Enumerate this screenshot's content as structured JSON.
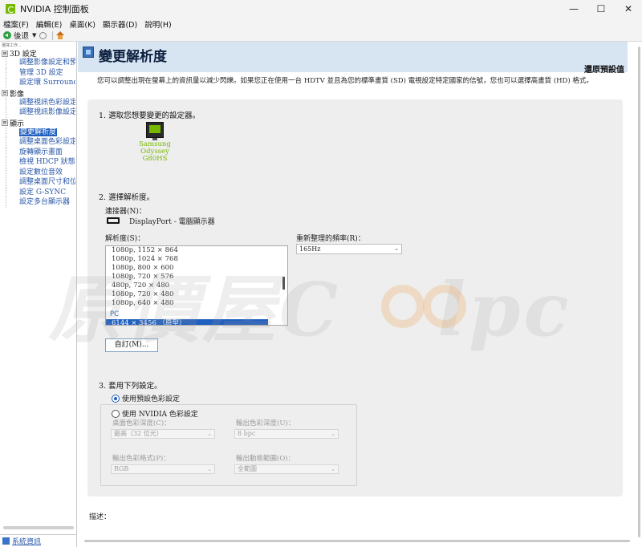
{
  "window": {
    "title": "NVIDIA 控制面板",
    "controls": {
      "minimize": "—",
      "maximize": "☐",
      "close": "✕"
    }
  },
  "menubar": {
    "items": [
      "檔案(F)",
      "編輯(E)",
      "桌面(K)",
      "顯示器(D)",
      "說明(H)"
    ]
  },
  "toolbar": {
    "back_label": "後退",
    "back_caret": "▼"
  },
  "sidebar": {
    "hint": "選擇工作...",
    "groups": [
      {
        "label": "3D 設定",
        "toggle": "⊟",
        "children": [
          "調整影像設定和預覽",
          "管理 3D 設定",
          "設定環 Surround、PhysX"
        ]
      },
      {
        "label": "影像",
        "toggle": "⊟",
        "children": [
          "調整視訊色彩設定",
          "調整視訊影像設定"
        ]
      },
      {
        "label": "顯示",
        "toggle": "⊟",
        "children": [
          "變更解析度",
          "調整桌面色彩設定",
          "旋轉顯示畫面",
          "檢視 HDCP 狀態",
          "設定數位音效",
          "調整桌面尺寸和位置",
          "設定 G-SYNC",
          "設定多台顯示器"
        ],
        "selected_index": 0
      }
    ],
    "footer_link": "系統資訊"
  },
  "main": {
    "title": "變更解析度",
    "restore_label": "還原預設值",
    "description": "您可以調整出現在螢幕上的資訊量以減少閃爍。如果您正在使用一台 HDTV 並且為您的標準畫質 (SD) 電視設定特定國家的信號，您也可以選擇高畫質 (HD) 格式。",
    "step1": {
      "heading": "1. 選取您想要變更的設定器。",
      "monitor_name_line1": "Samsung Odyssey",
      "monitor_name_line2": "G80HS"
    },
    "step2": {
      "heading": "2. 選擇解析度。",
      "connector_label": "連接器(N)：",
      "connector_value": "DisplayPort - 電腦顯示器",
      "resolution_label": "解析度(S)：",
      "resolutions": [
        "1080p, 1152 × 864",
        "1080p, 1024 × 768",
        "1080p, 800 × 600",
        "1080p, 720 × 576",
        "480p, 720 × 480",
        "1080p, 720 × 480",
        "1080p, 640 × 480"
      ],
      "group_label": "PC",
      "selected_resolution": "6144 × 3456 （原型）",
      "refresh_label": "重新整理的頻率(R)：",
      "refresh_value": "165Hz",
      "custom_button": "自訂(M)..."
    },
    "step3": {
      "heading": "3. 套用下列設定。",
      "option_default": "使用預設色彩設定",
      "option_nvidia": "使用 NVIDIA 色彩設定",
      "desktop_depth_label": "桌面色彩深度(C)：",
      "desktop_depth_value": "最高（32 位元）",
      "output_depth_label": "輸出色彩深度(U)：",
      "output_depth_value": "8 bpc",
      "output_format_label": "輸出色彩格式(P)：",
      "output_format_value": "RGB",
      "dynamic_range_label": "輸出動態範圍(O)：",
      "dynamic_range_value": "全範圍"
    },
    "describe_label": "描述："
  },
  "watermark": {
    "text": "原價屋C",
    "suffix": "lpc"
  },
  "colors": {
    "accent_blue": "#1f5fbf",
    "nvidia_green": "#76b900",
    "header_bg": "#d7e4f2",
    "panel_bg": "#eeeeee"
  }
}
